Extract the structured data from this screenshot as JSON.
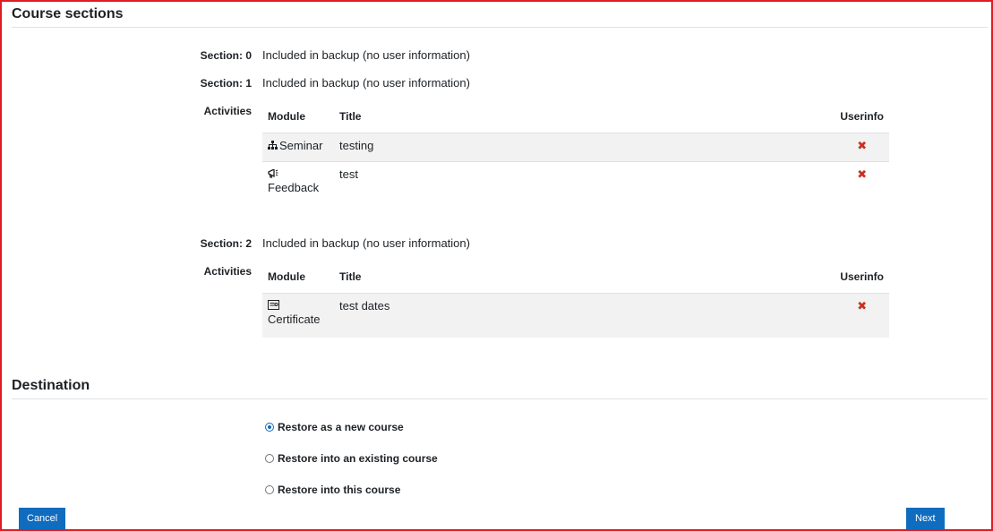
{
  "course_sections": {
    "heading": "Course sections",
    "sections": [
      {
        "label": "Section: 0",
        "value": "Included in backup (no user information)"
      },
      {
        "label": "Section: 1",
        "value": "Included in backup (no user information)"
      },
      {
        "label": "Section: 2",
        "value": "Included in backup (no user information)"
      }
    ],
    "activities_label": "Activities",
    "columns": {
      "module": "Module",
      "title": "Title",
      "userinfo": "Userinfo"
    },
    "section1_activities": [
      {
        "module": "Seminar",
        "module_icon": "seminar-icon",
        "title": "testing",
        "userinfo": "✖"
      },
      {
        "module": "Feedback",
        "module_icon": "feedback-icon",
        "title": "test",
        "userinfo": "✖"
      }
    ],
    "section2_activities": [
      {
        "module": "Certificate",
        "module_icon": "certificate-icon",
        "title": "test dates",
        "userinfo": "✖"
      }
    ]
  },
  "destination": {
    "heading": "Destination",
    "options": [
      {
        "label": "Restore as a new course",
        "selected": true
      },
      {
        "label": "Restore into an existing course",
        "selected": false
      },
      {
        "label": "Restore into this course",
        "selected": false
      }
    ]
  },
  "buttons": {
    "cancel": "Cancel",
    "next": "Next"
  },
  "colors": {
    "primary": "#0f6cbf",
    "danger": "#ca3120",
    "frame": "#e01b24"
  }
}
